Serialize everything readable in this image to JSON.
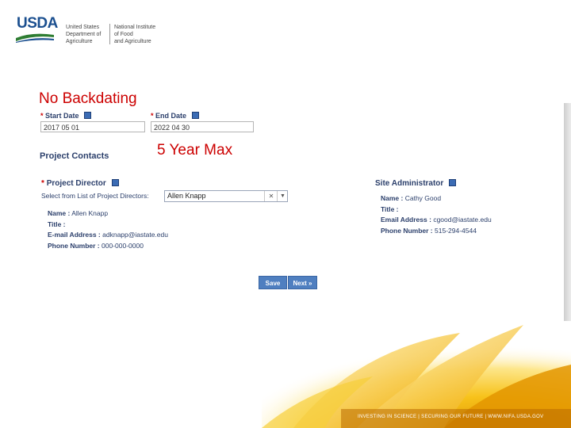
{
  "header": {
    "logo_text": "USDA",
    "agency_line1": [
      "United States",
      "Department of",
      "Agriculture"
    ],
    "agency_line2": [
      "National Institute",
      "of Food",
      "and Agriculture"
    ]
  },
  "annotations": {
    "no_backdating": "No Backdating",
    "five_year_max": "5 Year Max"
  },
  "dates": {
    "start_label": "Start Date",
    "start_value": "2017 05 01",
    "end_label": "End Date",
    "end_value": "2022 04 30",
    "required_marker": "*"
  },
  "contacts": {
    "section_title": "Project Contacts",
    "project_director": {
      "label": "Project Director",
      "select_label": "Select from List of Project Directors:",
      "selected": "Allen Knapp",
      "name_label": "Name :",
      "name": "Allen Knapp",
      "title_label": "Title :",
      "title": "",
      "email_label": "E-mail Address :",
      "email": "adknapp@iastate.edu",
      "phone_label": "Phone Number :",
      "phone": "000-000-0000"
    },
    "site_administrator": {
      "label": "Site Administrator",
      "name_label": "Name :",
      "name": "Cathy Good",
      "title_label": "Title :",
      "title": "",
      "email_label": "Email Address :",
      "email": "cgood@iastate.edu",
      "phone_label": "Phone Number :",
      "phone": "515-294-4544"
    }
  },
  "buttons": {
    "save": "Save",
    "next": "Next »"
  },
  "footer": {
    "tagline": "INVESTING IN SCIENCE | SECURING OUR FUTURE | WWW.NIFA.USDA.GOV"
  },
  "colors": {
    "annotation_red": "#cc0000",
    "label_navy": "#2b3f6b",
    "button_blue": "#4f7fc0",
    "usda_blue": "#1b4f8f",
    "usda_green": "#2e7d32"
  }
}
